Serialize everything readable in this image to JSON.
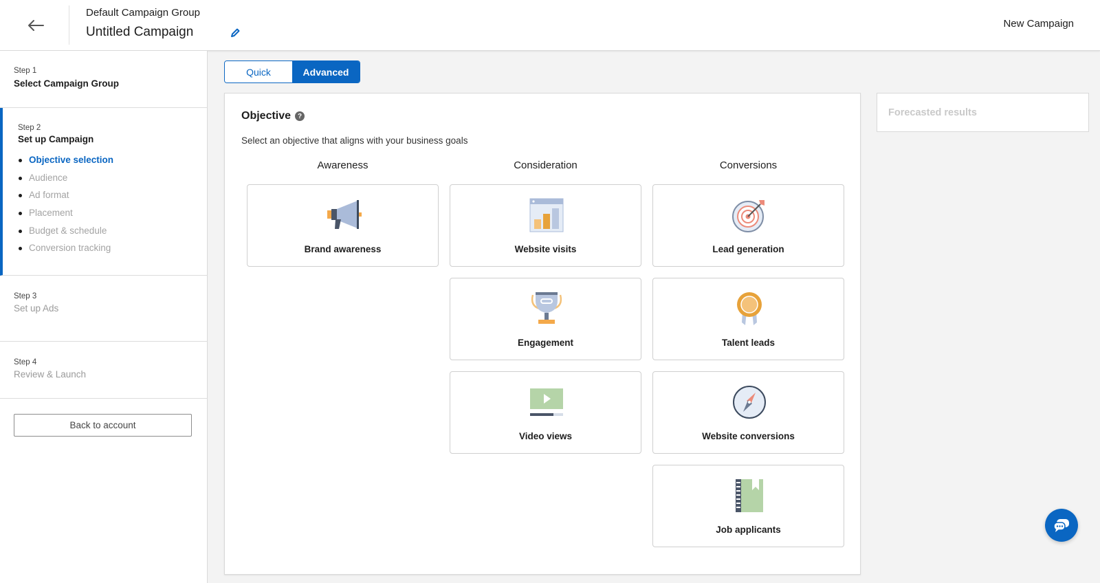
{
  "header": {
    "back_icon": "arrow-left-icon",
    "group_name": "Default Campaign Group",
    "campaign_name": "Untitled Campaign",
    "edit_icon": "pencil-icon",
    "right_label": "New Campaign"
  },
  "sidebar": {
    "steps": [
      {
        "num": "Step 1",
        "title": "Select Campaign Group"
      },
      {
        "num": "Step 2",
        "title": "Set up Campaign"
      },
      {
        "num": "Step 3",
        "title": "Set up Ads"
      },
      {
        "num": "Step 4",
        "title": "Review & Launch"
      }
    ],
    "substeps": [
      "Objective selection",
      "Audience",
      "Ad format",
      "Placement",
      "Budget & schedule",
      "Conversion tracking"
    ],
    "back_button": "Back to account"
  },
  "mode_toggle": {
    "quick": "Quick",
    "advanced": "Advanced",
    "selected": "Advanced"
  },
  "objective": {
    "title": "Objective",
    "help_icon": "question-icon",
    "subtitle": "Select an objective that aligns with your business goals",
    "columns": [
      {
        "heading": "Awareness",
        "items": [
          {
            "label": "Brand awareness",
            "icon": "megaphone-icon"
          }
        ]
      },
      {
        "heading": "Consideration",
        "items": [
          {
            "label": "Website visits",
            "icon": "browser-chart-icon"
          },
          {
            "label": "Engagement",
            "icon": "trophy-icon"
          },
          {
            "label": "Video views",
            "icon": "video-player-icon"
          }
        ]
      },
      {
        "heading": "Conversions",
        "items": [
          {
            "label": "Lead generation",
            "icon": "target-icon"
          },
          {
            "label": "Talent leads",
            "icon": "badge-ribbon-icon"
          },
          {
            "label": "Website conversions",
            "icon": "compass-icon"
          },
          {
            "label": "Job applicants",
            "icon": "notebook-icon"
          }
        ]
      }
    ]
  },
  "forecast": {
    "title": "Forecasted results"
  },
  "chat": {
    "icon": "chat-bubble-icon"
  },
  "colors": {
    "accent": "#0a66c2",
    "muted_text": "#a3a3a3"
  }
}
